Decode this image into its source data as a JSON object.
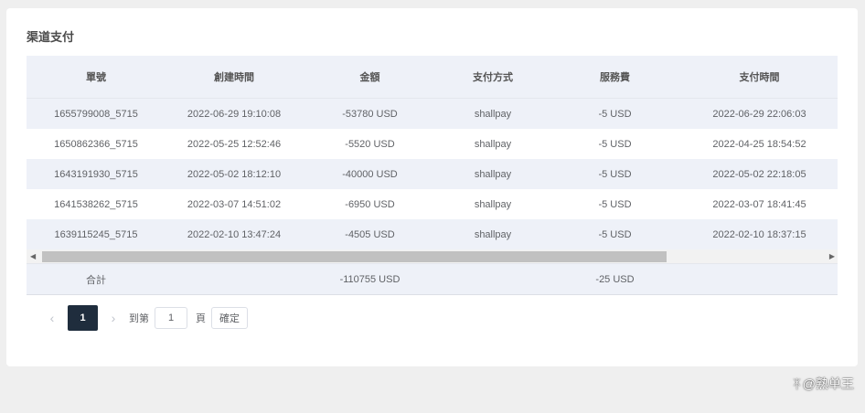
{
  "card": {
    "title": "渠道支付"
  },
  "table": {
    "headers": [
      "單號",
      "創建時間",
      "金額",
      "支付方式",
      "服務費",
      "支付時間"
    ],
    "rows": [
      [
        "1655799008_5715",
        "2022-06-29 19:10:08",
        "-53780 USD",
        "shallpay",
        "-5 USD",
        "2022-06-29 22:06:03"
      ],
      [
        "1650862366_5715",
        "2022-05-25 12:52:46",
        "-5520 USD",
        "shallpay",
        "-5 USD",
        "2022-04-25 18:54:52"
      ],
      [
        "1643191930_5715",
        "2022-05-02 18:12:10",
        "-40000 USD",
        "shallpay",
        "-5 USD",
        "2022-05-02 22:18:05"
      ],
      [
        "1641538262_5715",
        "2022-03-07 14:51:02",
        "-6950 USD",
        "shallpay",
        "-5 USD",
        "2022-03-07 18:41:45"
      ],
      [
        "1639115245_5715",
        "2022-02-10 13:47:24",
        "-4505 USD",
        "shallpay",
        "-5 USD",
        "2022-02-10 18:37:15"
      ]
    ],
    "total": {
      "label": "合計",
      "amount": "-110755 USD",
      "fee": "-25 USD"
    }
  },
  "pagination": {
    "prev_icon": "‹",
    "next_icon": "›",
    "current_page": "1",
    "goto_label": "到第",
    "goto_value": "1",
    "page_suffix": "頁",
    "confirm_label": "確定"
  },
  "watermark": {
    "text": "@熟单王"
  },
  "colors": {
    "header_bg": "#eef1f8",
    "current_page_bg": "#1f2d3d"
  }
}
